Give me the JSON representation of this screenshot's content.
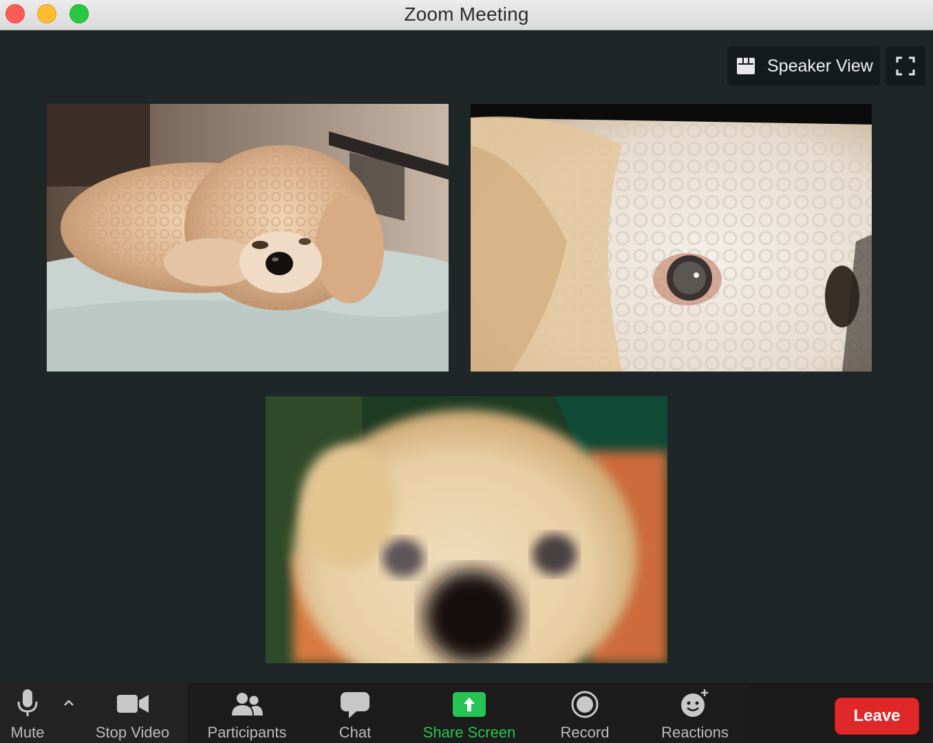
{
  "window": {
    "title": "Zoom Meeting"
  },
  "view_controls": {
    "speaker_view_label": "Speaker View"
  },
  "participants": [
    {
      "video": "fluffy-apricot-poodle-lying-on-bed"
    },
    {
      "video": "closeup-white-poodle-eye"
    },
    {
      "video": "blurry-closeup-dog-face"
    }
  ],
  "toolbar": {
    "mute_label": "Mute",
    "stop_video_label": "Stop Video",
    "participants_label": "Participants",
    "chat_label": "Chat",
    "share_screen_label": "Share Screen",
    "record_label": "Record",
    "reactions_label": "Reactions",
    "leave_label": "Leave"
  },
  "colors": {
    "background": "#1f2627",
    "toolbar": "#1a1a1a",
    "share_green": "#27c454",
    "leave_red": "#e02828"
  }
}
